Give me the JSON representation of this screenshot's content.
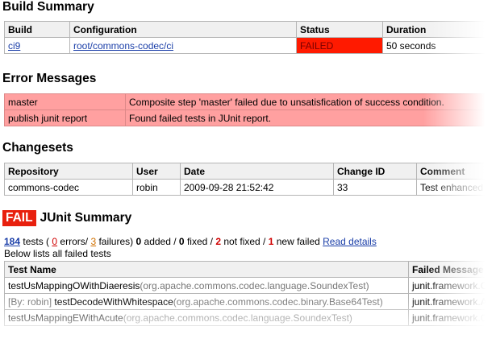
{
  "build_summary": {
    "title": "Build Summary",
    "headers": [
      "Build",
      "Configuration",
      "Status",
      "Duration"
    ],
    "row": {
      "build": "ci9",
      "configuration": "root/commons-codec/ci",
      "status": "FAILED",
      "duration": "50 seconds"
    }
  },
  "error_messages": {
    "title": "Error Messages",
    "rows": [
      {
        "name": "master",
        "message": "Composite step 'master' failed due to unsatisfication of success condition."
      },
      {
        "name": "publish junit report",
        "message": "Found failed tests in JUnit report."
      }
    ]
  },
  "changesets": {
    "title": "Changesets",
    "headers": [
      "Repository",
      "User",
      "Date",
      "Change ID",
      "Comment"
    ],
    "row": {
      "repository": "commons-codec",
      "user": "robin",
      "date": "2009-09-28 21:52:42",
      "change_id": "33",
      "comment": "Test enhanced by"
    }
  },
  "junit": {
    "badge": "FAIL",
    "title": "JUnit Summary",
    "total": "184",
    "tests_word": "tests",
    "errors": "0",
    "errors_word": "errors/",
    "failures": "3",
    "failures_word": "failures)",
    "added": "0",
    "added_word": "added /",
    "fixed": "0",
    "fixed_word": "fixed /",
    "not_fixed": "2",
    "not_fixed_word": "not fixed /",
    "new_failed": "1",
    "new_failed_word": "new failed",
    "read_details": "Read details",
    "below_text": "Below lists all failed tests",
    "headers": [
      "Test Name",
      "Failed Message"
    ],
    "rows": [
      {
        "prefix": "",
        "name": "testUsMappingOWithDiaeresis",
        "cls": "(org.apache.commons.codec.language.SoundexTest)",
        "msg": "junit.framework.Co"
      },
      {
        "prefix": "[By: robin]",
        "name": "testDecodeWithWhitespace",
        "cls": "(org.apache.commons.codec.binary.Base64Test)",
        "msg": "junit.framework.As"
      },
      {
        "prefix": "",
        "name": "testUsMappingEWithAcute",
        "cls": "(org.apache.commons.codec.language.SoundexTest)",
        "msg": "junit.framework.Co"
      }
    ]
  }
}
